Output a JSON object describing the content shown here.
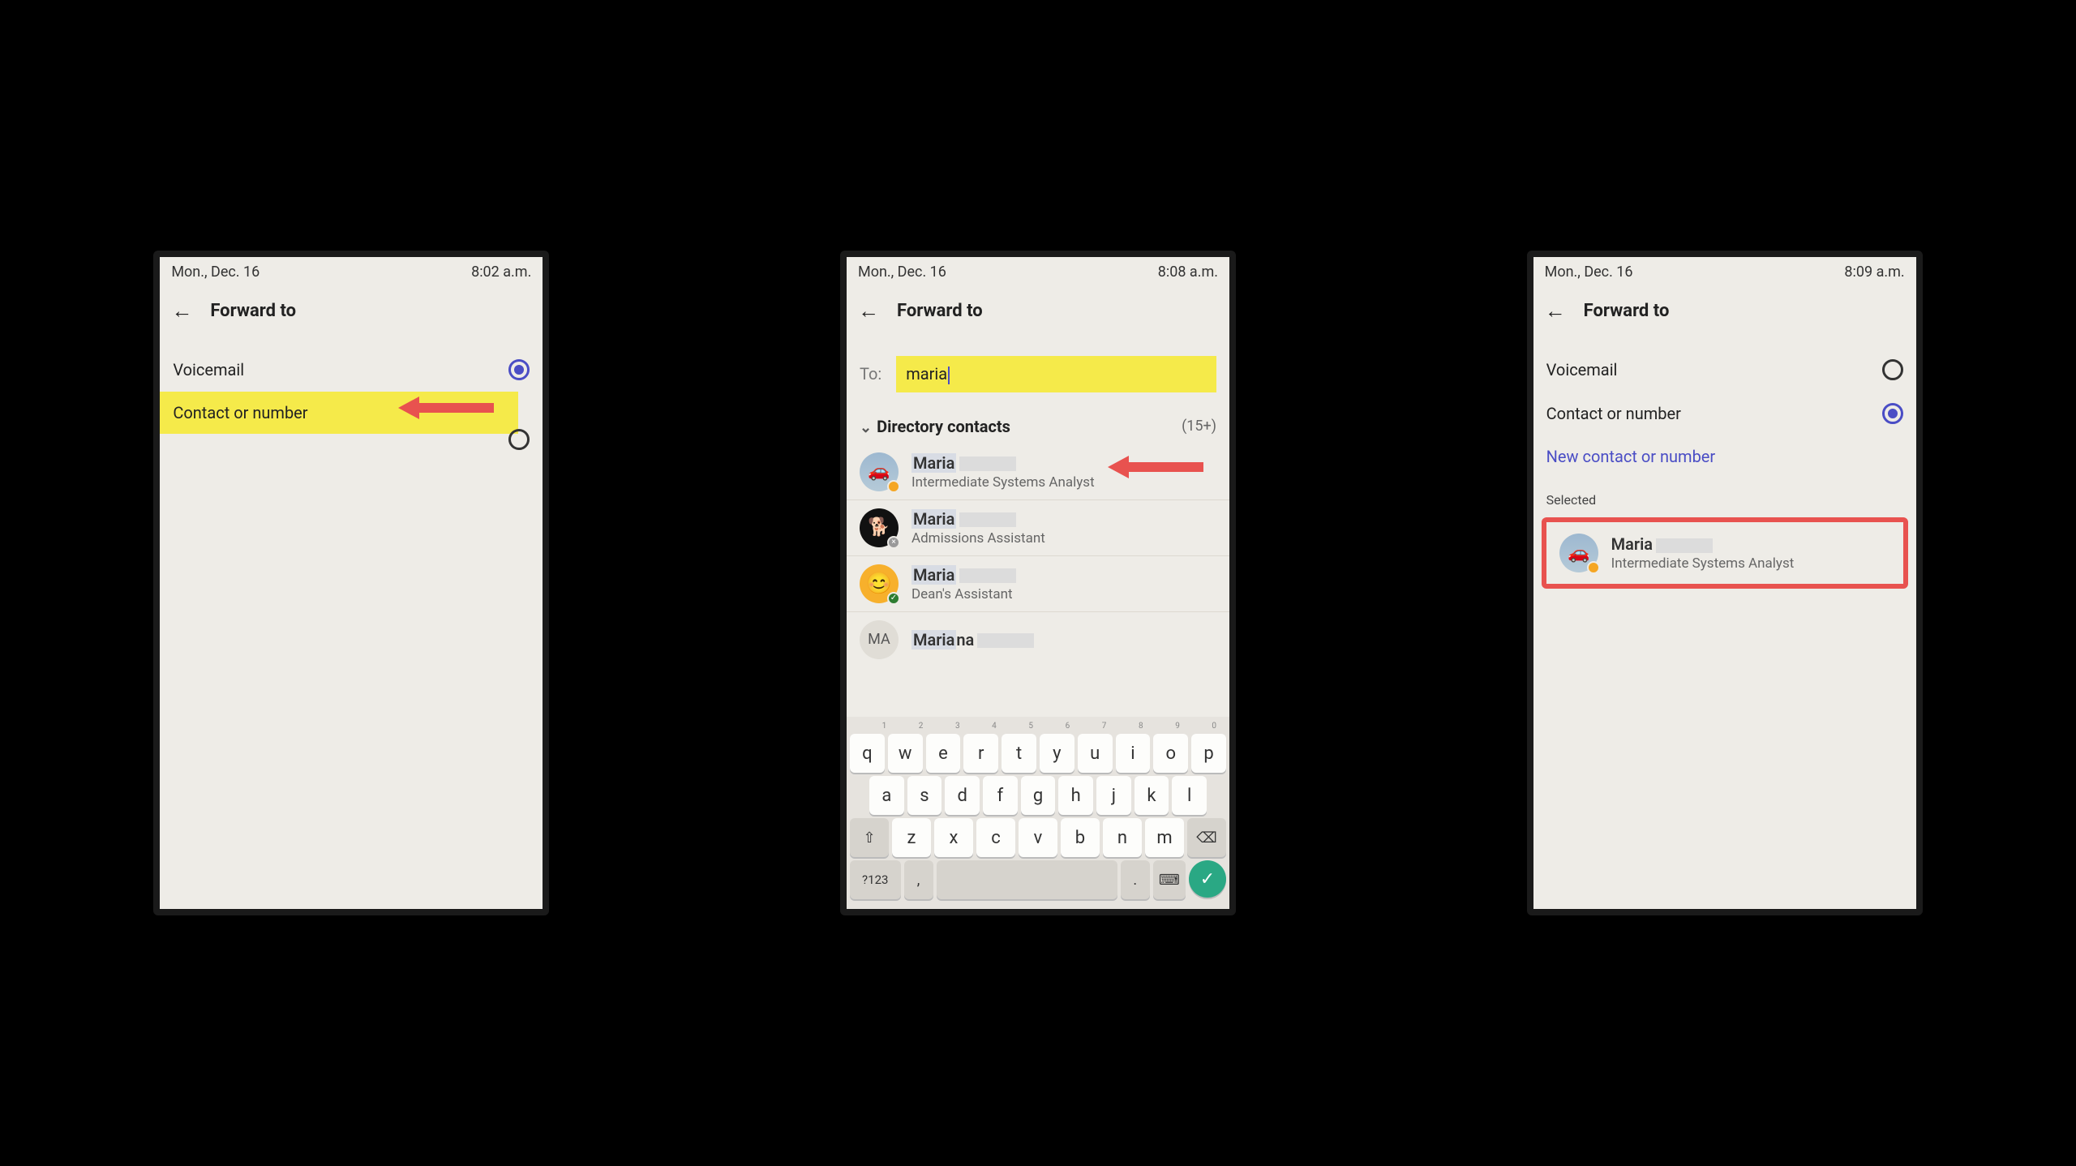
{
  "panel1": {
    "status_date": "Mon., Dec. 16",
    "status_time": "8:02 a.m.",
    "title": "Forward to",
    "options": {
      "voicemail": "Voicemail",
      "contact_or_number": "Contact or number"
    }
  },
  "panel2": {
    "status_date": "Mon., Dec. 16",
    "status_time": "8:08 a.m.",
    "title": "Forward to",
    "to_label": "To:",
    "to_value": "maria",
    "dir_header": "Directory contacts",
    "dir_count": "(15+)",
    "contacts": [
      {
        "name": "Maria",
        "role": "Intermediate Systems Analyst",
        "avatar": "car",
        "presence": "away"
      },
      {
        "name": "Maria",
        "role": "Admissions Assistant",
        "avatar": "dog",
        "presence": "offline"
      },
      {
        "name": "Maria",
        "role": "Dean's Assistant",
        "avatar": "smile",
        "presence": "available"
      },
      {
        "name": "Mariana",
        "role": "",
        "avatar": "initials",
        "initials": "MA",
        "presence": "none"
      }
    ],
    "keyboard": {
      "nums": [
        "1",
        "2",
        "3",
        "4",
        "5",
        "6",
        "7",
        "8",
        "9",
        "0"
      ],
      "row1": [
        "q",
        "w",
        "e",
        "r",
        "t",
        "y",
        "u",
        "i",
        "o",
        "p"
      ],
      "row2": [
        "a",
        "s",
        "d",
        "f",
        "g",
        "h",
        "j",
        "k",
        "l"
      ],
      "row3": [
        "⇧",
        "z",
        "x",
        "c",
        "v",
        "b",
        "n",
        "m",
        "⌫"
      ],
      "row4_sym": "?123",
      "row4_comma": ",",
      "row4_dot": "."
    }
  },
  "panel3": {
    "status_date": "Mon., Dec. 16",
    "status_time": "8:09 a.m.",
    "title": "Forward to",
    "options": {
      "voicemail": "Voicemail",
      "contact_or_number": "Contact or number"
    },
    "new_contact": "New contact or number",
    "selected_label": "Selected",
    "selected": {
      "name": "Maria",
      "role": "Intermediate Systems Analyst",
      "avatar": "car",
      "presence": "away"
    }
  }
}
